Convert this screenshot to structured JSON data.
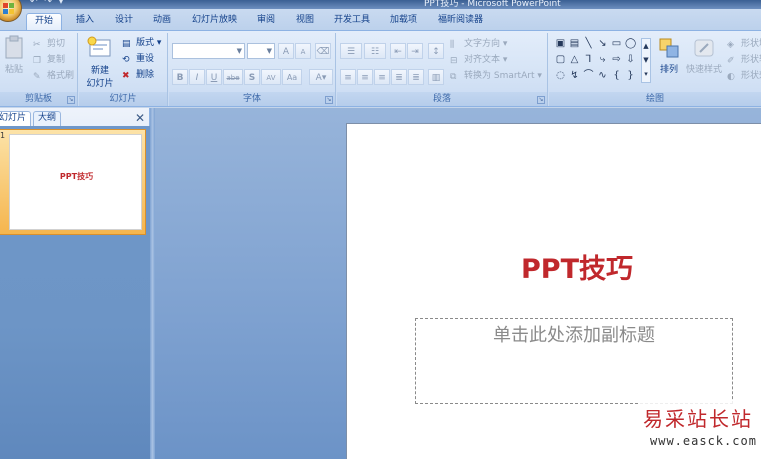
{
  "titlebar": {
    "qat": "↶ ↷ ▾",
    "title": "PPT技巧 - Microsoft PowerPoint"
  },
  "tabs": [
    "开始",
    "插入",
    "设计",
    "动画",
    "幻灯片放映",
    "审阅",
    "视图",
    "开发工具",
    "加载项",
    "福昕阅读器"
  ],
  "ribbon": {
    "clipboard": {
      "label": "剪贴板",
      "paste": "粘贴",
      "cut": "剪切",
      "copy": "复制",
      "format_painter": "格式刷"
    },
    "slides": {
      "label": "幻灯片",
      "new_slide_line1": "新建",
      "new_slide_line2": "幻灯片",
      "layout": "版式",
      "reset": "重设",
      "delete": "删除"
    },
    "font": {
      "label": "字体",
      "bold": "B",
      "italic": "I",
      "underline": "U",
      "strike": "abe",
      "shadow": "S",
      "spacing": "AV",
      "case": "Aa",
      "grow": "A",
      "shrink": "A"
    },
    "paragraph": {
      "label": "段落",
      "text_direction": "文字方向",
      "align_text": "对齐文本",
      "smartart": "转换为 SmartArt"
    },
    "drawing": {
      "label": "绘图",
      "arrange": "排列",
      "quick_styles": "快速样式",
      "shape_fill": "形状填充",
      "shape_outline": "形状轮廓",
      "shape_effects": "形状效果"
    }
  },
  "left_pane": {
    "tab_slides": "幻灯片",
    "tab_outline": "大纲",
    "close": "✕",
    "thumbnail_number": "1",
    "thumbnail_title": "PPT技巧"
  },
  "slide": {
    "title": "PPT技巧",
    "subtitle_placeholder": "单击此处添加副标题"
  },
  "watermark": {
    "line1": "易采站长站",
    "line2": "www.easck.com"
  },
  "colors": {
    "accent_red": "#c0282c",
    "ribbon_text": "#15428b",
    "workspace_blue": "#7ea1d0"
  }
}
